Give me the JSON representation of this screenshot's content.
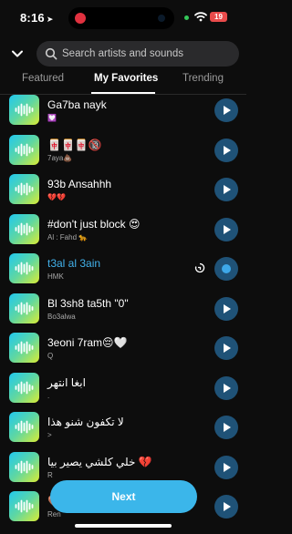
{
  "status": {
    "time": "8:16",
    "location_icon": "location-arrow-icon",
    "battery": "19",
    "accent_record": "#e0313f",
    "battery_color": "#e94b4b"
  },
  "search": {
    "placeholder": "Search artists and sounds"
  },
  "tabs": [
    {
      "label": "Featured",
      "active": false
    },
    {
      "label": "My Favorites",
      "active": true
    },
    {
      "label": "Trending",
      "active": false
    }
  ],
  "sounds": [
    {
      "title": "Ga7ba nayk",
      "subtitle": "💟"
    },
    {
      "title": "🀄🀄🀄🔞",
      "subtitle": "7aya💩"
    },
    {
      "title": "93b Ansahhh",
      "subtitle": "💔💔"
    },
    {
      "title": "#don't just block 😍",
      "subtitle": "Al : Fahd 🐆"
    },
    {
      "title": "t3al al 3ain",
      "subtitle": "HMK",
      "playing": true
    },
    {
      "title": "Bl 3sh8 ta5th \"0\"",
      "subtitle": "Bo3alwa"
    },
    {
      "title": "3eoni 7ram😔🤍",
      "subtitle": "Q"
    },
    {
      "title": "ابغا انتهر",
      "subtitle": "."
    },
    {
      "title": "لا تكفون شنو هذا",
      "subtitle": ">"
    },
    {
      "title": "خلي كلشي يصير بيا 💔",
      "subtitle": "R"
    },
    {
      "title": "🤎🐆🐆🐆",
      "subtitle": "Ren"
    }
  ],
  "next_button": {
    "label": "Next"
  },
  "colors": {
    "accent": "#3bb6ea",
    "playing_title": "#42b1ea",
    "play_button_bg": "#1f5277",
    "background": "#0d0d0d"
  }
}
